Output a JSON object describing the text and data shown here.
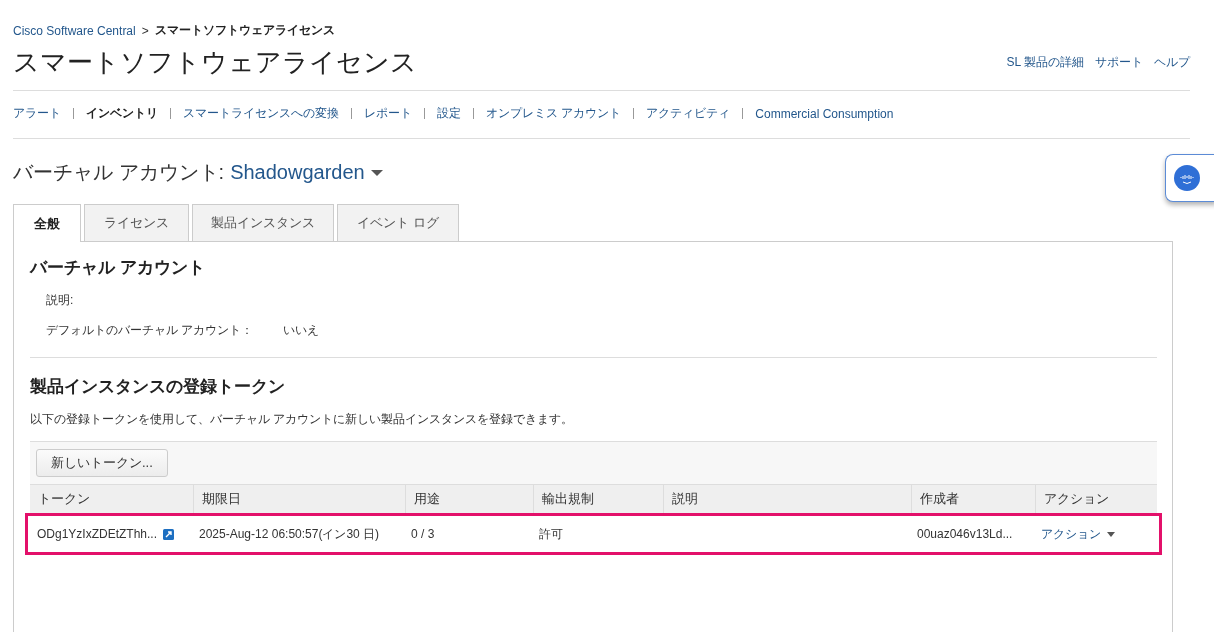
{
  "breadcrumb": {
    "link": "Cisco Software Central",
    "separator": ">",
    "current": "スマートソフトウェアライセンス"
  },
  "page_title": "スマートソフトウェアライセンス",
  "header_links": [
    "SL 製品の詳細",
    "サポート",
    "ヘルプ"
  ],
  "nav": [
    {
      "label": "アラート",
      "selected": false
    },
    {
      "label": "インベントリ",
      "selected": true
    },
    {
      "label": "スマートライセンスへの変換",
      "selected": false
    },
    {
      "label": "レポート",
      "selected": false
    },
    {
      "label": "設定",
      "selected": false
    },
    {
      "label": "オンプレミス アカウント",
      "selected": false
    },
    {
      "label": "アクティビティ",
      "selected": false
    },
    {
      "label": "Commercial Consumption",
      "selected": false
    }
  ],
  "virtual_account": {
    "label": "バーチャル アカウント:",
    "name": "Shadowgarden"
  },
  "tabs": [
    {
      "label": "全般",
      "selected": true
    },
    {
      "label": "ライセンス",
      "selected": false
    },
    {
      "label": "製品インスタンス",
      "selected": false
    },
    {
      "label": "イベント ログ",
      "selected": false
    }
  ],
  "account_section": {
    "title": "バーチャル アカウント",
    "fields": [
      {
        "label": "説明:"
      },
      {
        "label": "デフォルトのバーチャル アカウント：",
        "value": "いいえ"
      }
    ]
  },
  "token_section": {
    "title": "製品インスタンスの登録トークン",
    "description": "以下の登録トークンを使用して、バーチャル アカウントに新しい製品インスタンスを登録できます。",
    "new_token_button": "新しいトークン...",
    "table": {
      "columns": [
        "トークン",
        "期限日",
        "用途",
        "輸出規制",
        "説明",
        "作成者",
        "アクション"
      ],
      "rows": [
        {
          "highlighted": true,
          "token": "ODg1YzIxZDEtZThh...",
          "expires": "2025-Aug-12 06:50:57(イン30 日)",
          "uses": "0 / 3",
          "export_control": "許可",
          "created_by": "00uaz046v13Ld...",
          "action": "アクション"
        }
      ]
    }
  }
}
